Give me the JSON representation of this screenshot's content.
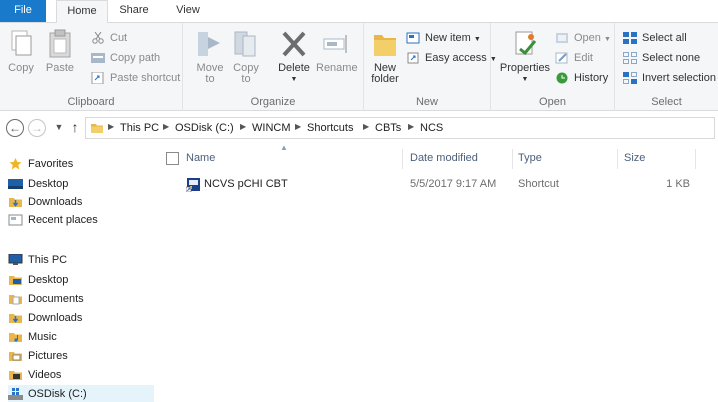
{
  "ribbon_tabs": {
    "file": "File",
    "home": "Home",
    "share": "Share",
    "view": "View"
  },
  "clipboard": {
    "label": "Clipboard",
    "copy": "Copy",
    "paste": "Paste",
    "cut": "Cut",
    "copy_path": "Copy path",
    "paste_shortcut": "Paste shortcut"
  },
  "organize": {
    "label": "Organize",
    "move_to": "Move",
    "move_to_2": "to",
    "copy_to": "Copy",
    "copy_to_2": "to",
    "delete": "Delete",
    "rename": "Rename"
  },
  "new_group": {
    "label": "New",
    "new_folder": "New",
    "new_folder_2": "folder",
    "new_item": "New item",
    "easy_access": "Easy access"
  },
  "open_group": {
    "label": "Open",
    "properties": "Properties",
    "open": "Open",
    "edit": "Edit",
    "history": "History"
  },
  "select_group": {
    "label": "Select",
    "select_all": "Select all",
    "select_none": "Select none",
    "invert_selection": "Invert selection"
  },
  "address": {
    "crumbs": [
      "This PC",
      "OSDisk (C:)",
      "WINCM",
      "Shortcuts",
      "CBTs",
      "NCS"
    ]
  },
  "nav_pane": {
    "favorites": "Favorites",
    "fav_items": [
      "Desktop",
      "Downloads",
      "Recent places"
    ],
    "this_pc": "This PC",
    "pc_items": [
      "Desktop",
      "Documents",
      "Downloads",
      "Music",
      "Pictures",
      "Videos",
      "OSDisk (C:)"
    ]
  },
  "columns": {
    "name": "Name",
    "date": "Date modified",
    "type": "Type",
    "size": "Size"
  },
  "files": [
    {
      "name": "NCVS pCHI CBT",
      "date": "5/5/2017 9:17 AM",
      "type": "Shortcut",
      "size": "1 KB"
    }
  ],
  "colors": {
    "accent": "#1979ca",
    "folder": "#e8b64b",
    "selected": "#e5f3fb"
  }
}
